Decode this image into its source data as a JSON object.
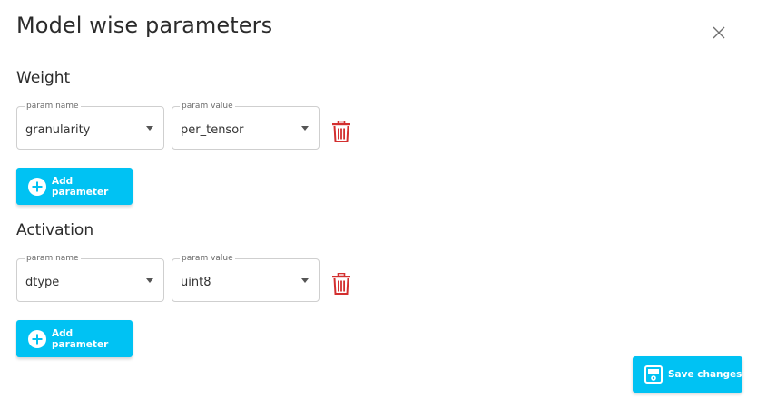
{
  "dialog": {
    "title": "Model wise parameters"
  },
  "icons": {
    "close": "close-icon",
    "delete": "trash-icon",
    "add": "plus-circle-icon",
    "save": "floppy-disk-icon"
  },
  "colors": {
    "accent": "#00c2f3",
    "delete": "#d32f2f",
    "field_border": "#cfcfcf"
  },
  "weight": {
    "heading": "Weight",
    "rows": [
      {
        "name_label": "param name",
        "name_value": "granularity",
        "value_label": "param value",
        "value_value": "per_tensor"
      }
    ],
    "add_label": "Add parameter"
  },
  "activation": {
    "heading": "Activation",
    "rows": [
      {
        "name_label": "param name",
        "name_value": "dtype",
        "value_label": "param value",
        "value_value": "uint8"
      }
    ],
    "add_label": "Add parameter"
  },
  "footer": {
    "save_label": "Save changes"
  }
}
